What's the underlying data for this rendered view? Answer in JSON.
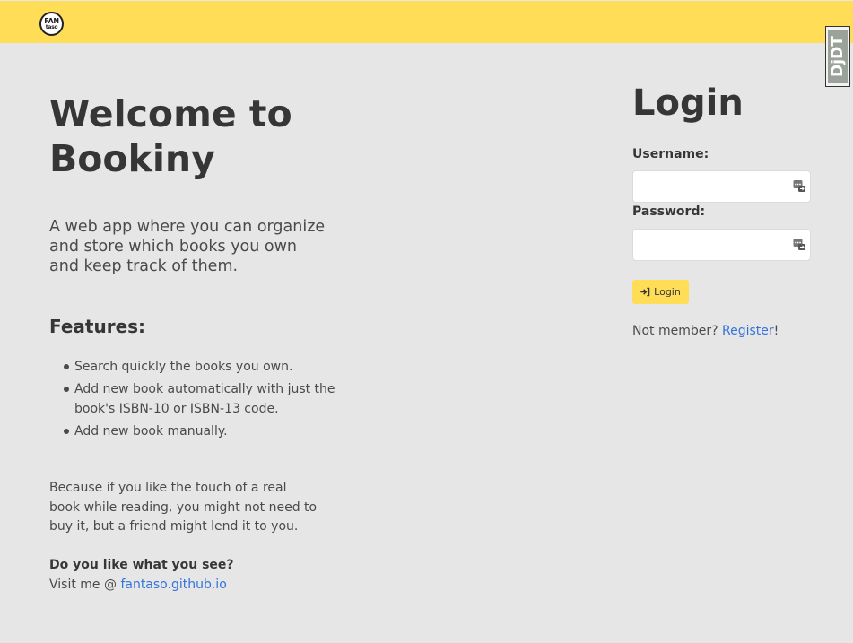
{
  "navbar": {
    "logo_line1": "FAN",
    "logo_line2": "taso",
    "debug_toolbar_label": "DjDT"
  },
  "hero": {
    "title_line1": "Welcome to",
    "title_line2": "Bookiny",
    "subtitle": "A web app where you can organize and store which books you own and keep track of them."
  },
  "features": {
    "title": "Features:",
    "items": [
      "Search quickly the books you own.",
      "Add new book automatically with just the book's ISBN-10 or ISBN-13 code.",
      "Add new book manually."
    ]
  },
  "footer_text": {
    "because": "Because if you like the touch of a real book while reading, you might not need to buy it, but a friend might lend it to you.",
    "question": "Do you like what you see?",
    "visit_prefix": "Visit me @ ",
    "visit_link": "fantaso.github.io"
  },
  "login": {
    "title": "Login",
    "username_label": "Username:",
    "username_value": "",
    "password_label": "Password:",
    "password_value": "",
    "button_label": "Login",
    "not_member_text": "Not member? ",
    "register_link": "Register",
    "register_suffix": "!"
  },
  "colors": {
    "navbar": "#ffdd57",
    "background": "#e6e6e6",
    "link": "#3273dc",
    "button": "#ffdd57"
  },
  "icons": {
    "login_button": "sign-in-icon",
    "password_manager": "password-manager-icon"
  }
}
